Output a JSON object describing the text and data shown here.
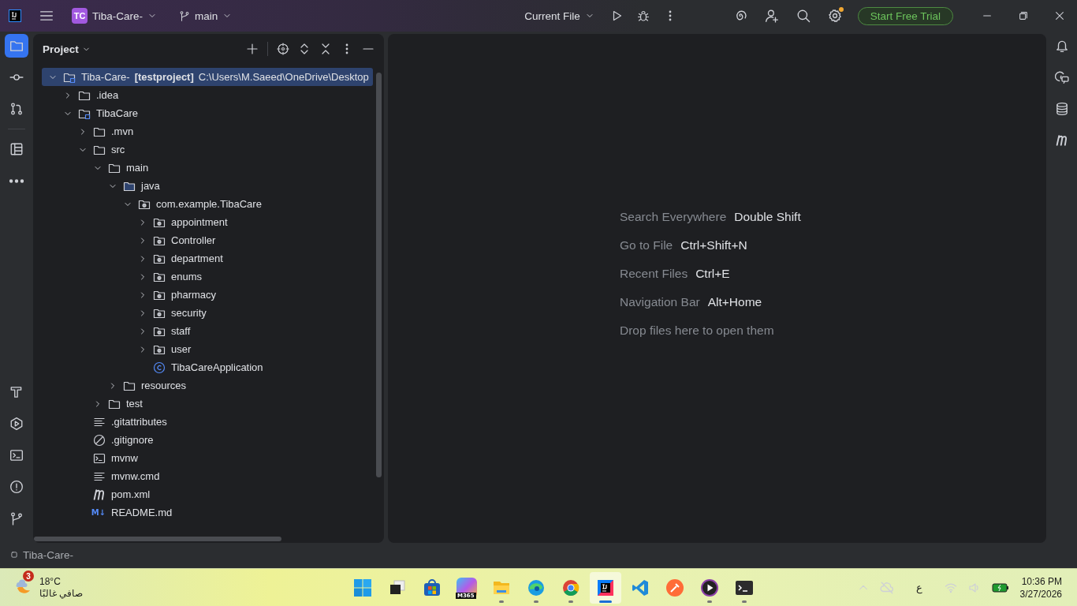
{
  "title_bar": {
    "project_badge": "TC",
    "project_name": "Tiba-Care-",
    "branch": "main",
    "run_config": "Current File",
    "trial_button": "Start Free Trial",
    "settings_update_dot": true
  },
  "left_tools": [
    {
      "kind": "folder",
      "selected": true
    },
    {
      "kind": "commit",
      "selected": false
    },
    {
      "kind": "pull-requests",
      "selected": false
    },
    {
      "kind": "structure",
      "selected": false
    },
    {
      "kind": "more",
      "selected": false
    }
  ],
  "left_tools_bottom": [
    {
      "kind": "build",
      "selected": false
    },
    {
      "kind": "services",
      "selected": false
    },
    {
      "kind": "terminal",
      "selected": false
    },
    {
      "kind": "problems",
      "selected": false
    },
    {
      "kind": "git",
      "selected": false
    }
  ],
  "right_tools": [
    {
      "kind": "bell"
    },
    {
      "kind": "ai-chat"
    },
    {
      "kind": "database"
    },
    {
      "kind": "maven"
    }
  ],
  "project_panel": {
    "title": "Project",
    "tree": [
      {
        "name": "Tiba-Care-",
        "tag": "[testproject]",
        "path": "C:\\Users\\M.Saeed\\OneDrive\\Desktop",
        "kind": "project",
        "expanded": true,
        "selected": true,
        "children": [
          {
            "name": ".idea",
            "kind": "folder",
            "expanded": false,
            "selected": false
          },
          {
            "name": "TibaCare",
            "kind": "module",
            "expanded": true,
            "selected": false,
            "children": [
              {
                "name": ".mvn",
                "kind": "folder",
                "expanded": false,
                "selected": false
              },
              {
                "name": "src",
                "kind": "folder",
                "expanded": true,
                "selected": false,
                "children": [
                  {
                    "name": "main",
                    "kind": "folder",
                    "expanded": true,
                    "selected": false,
                    "children": [
                      {
                        "name": "java",
                        "kind": "source",
                        "expanded": true,
                        "selected": false,
                        "children": [
                          {
                            "name": "com.example.TibaCare",
                            "kind": "package",
                            "expanded": true,
                            "selected": false,
                            "children": [
                              {
                                "name": "appointment",
                                "kind": "package",
                                "expanded": false,
                                "selected": false
                              },
                              {
                                "name": "Controller",
                                "kind": "package",
                                "expanded": false,
                                "selected": false
                              },
                              {
                                "name": "department",
                                "kind": "package",
                                "expanded": false,
                                "selected": false
                              },
                              {
                                "name": "enums",
                                "kind": "package",
                                "expanded": false,
                                "selected": false
                              },
                              {
                                "name": "pharmacy",
                                "kind": "package",
                                "expanded": false,
                                "selected": false
                              },
                              {
                                "name": "security",
                                "kind": "package",
                                "expanded": false,
                                "selected": false
                              },
                              {
                                "name": "staff",
                                "kind": "package",
                                "expanded": false,
                                "selected": false
                              },
                              {
                                "name": "user",
                                "kind": "package",
                                "expanded": false,
                                "selected": false
                              },
                              {
                                "name": "TibaCareApplication",
                                "kind": "class",
                                "selected": false
                              }
                            ]
                          }
                        ]
                      },
                      {
                        "name": "resources",
                        "kind": "folder",
                        "expanded": false,
                        "selected": false
                      }
                    ]
                  },
                  {
                    "name": "test",
                    "kind": "folder",
                    "expanded": false,
                    "selected": false
                  }
                ]
              },
              {
                "name": ".gitattributes",
                "kind": "text",
                "selected": false
              },
              {
                "name": ".gitignore",
                "kind": "ignore",
                "selected": false
              },
              {
                "name": "mvnw",
                "kind": "script",
                "selected": false
              },
              {
                "name": "mvnw.cmd",
                "kind": "text",
                "selected": false
              },
              {
                "name": "pom.xml",
                "kind": "maven",
                "selected": false
              },
              {
                "name": "README.md",
                "kind": "markdown",
                "markdown_badge": "M↓",
                "selected": false
              }
            ]
          }
        ]
      }
    ]
  },
  "editor": {
    "hints": [
      {
        "action": "Search Everywhere",
        "shortcut": "Double Shift"
      },
      {
        "action": "Go to File",
        "shortcut": "Ctrl+Shift+N"
      },
      {
        "action": "Recent Files",
        "shortcut": "Ctrl+E"
      },
      {
        "action": "Navigation Bar",
        "shortcut": "Alt+Home"
      }
    ],
    "drop_hint": "Drop files here to open them"
  },
  "status_bar": {
    "breadcrumb": "Tiba-Care-"
  },
  "taskbar": {
    "weather": {
      "badge": "3",
      "temperature": "18°C",
      "condition": "صافي غالبًا"
    },
    "apps": [
      {
        "kind": "start",
        "running": false,
        "selected": false
      },
      {
        "kind": "task-view",
        "running": false,
        "selected": false
      },
      {
        "kind": "store",
        "running": false,
        "selected": false
      },
      {
        "kind": "m365",
        "label": "M365",
        "running": false,
        "selected": false
      },
      {
        "kind": "explorer",
        "running": true,
        "selected": false
      },
      {
        "kind": "edge",
        "running": true,
        "selected": false
      },
      {
        "kind": "chrome",
        "running": true,
        "selected": false
      },
      {
        "kind": "intellij",
        "running": true,
        "selected": true
      },
      {
        "kind": "vscode",
        "running": false,
        "selected": false
      },
      {
        "kind": "postman",
        "running": false,
        "selected": false
      },
      {
        "kind": "player",
        "running": true,
        "selected": false
      },
      {
        "kind": "terminal",
        "running": true,
        "selected": false
      }
    ],
    "tray": {
      "language": "ع",
      "time": "10:36 PM",
      "date": "3/27/2026"
    }
  }
}
